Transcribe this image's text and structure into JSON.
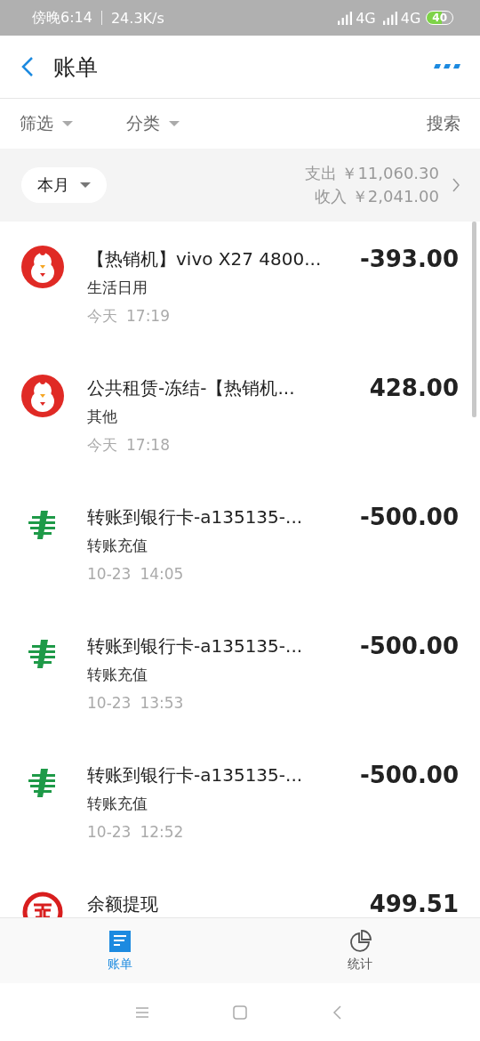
{
  "status_bar": {
    "time": "傍晚6:14",
    "speed": "24.3K/s",
    "network_1": "4G",
    "network_2": "4G",
    "battery": "40"
  },
  "header": {
    "title": "账单"
  },
  "filters": [
    {
      "label": "筛选"
    },
    {
      "label": "分类"
    }
  ],
  "search": "搜索",
  "summary": {
    "period": "本月",
    "expense_label": "支出",
    "expense": "￥11,060.30",
    "income_label": "收入",
    "income": "￥2,041.00"
  },
  "transactions": [
    {
      "kind": "chick",
      "title": "【热销机】vivo X27 4800...",
      "category": "生活日用",
      "date": "今天",
      "time": "17:19",
      "amount": "-393.00"
    },
    {
      "kind": "chick",
      "title": "公共租赁-冻结-【热销机...",
      "category": "其他",
      "date": "今天",
      "time": "17:18",
      "amount": "428.00"
    },
    {
      "kind": "postal",
      "title": "转账到银行卡-a135135-...",
      "category": "转账充值",
      "date": "10-23",
      "time": "14:05",
      "amount": "-500.00"
    },
    {
      "kind": "postal",
      "title": "转账到银行卡-a135135-...",
      "category": "转账充值",
      "date": "10-23",
      "time": "13:53",
      "amount": "-500.00"
    },
    {
      "kind": "postal",
      "title": "转账到银行卡-a135135-...",
      "category": "转账充值",
      "date": "10-23",
      "time": "12:52",
      "amount": "-500.00"
    },
    {
      "kind": "bank",
      "title": "余额提现",
      "amount": "499.51"
    }
  ],
  "tabs": [
    {
      "label": "账单",
      "kind": "bill",
      "selected": true
    },
    {
      "label": "统计",
      "kind": "stats",
      "selected": false
    }
  ]
}
